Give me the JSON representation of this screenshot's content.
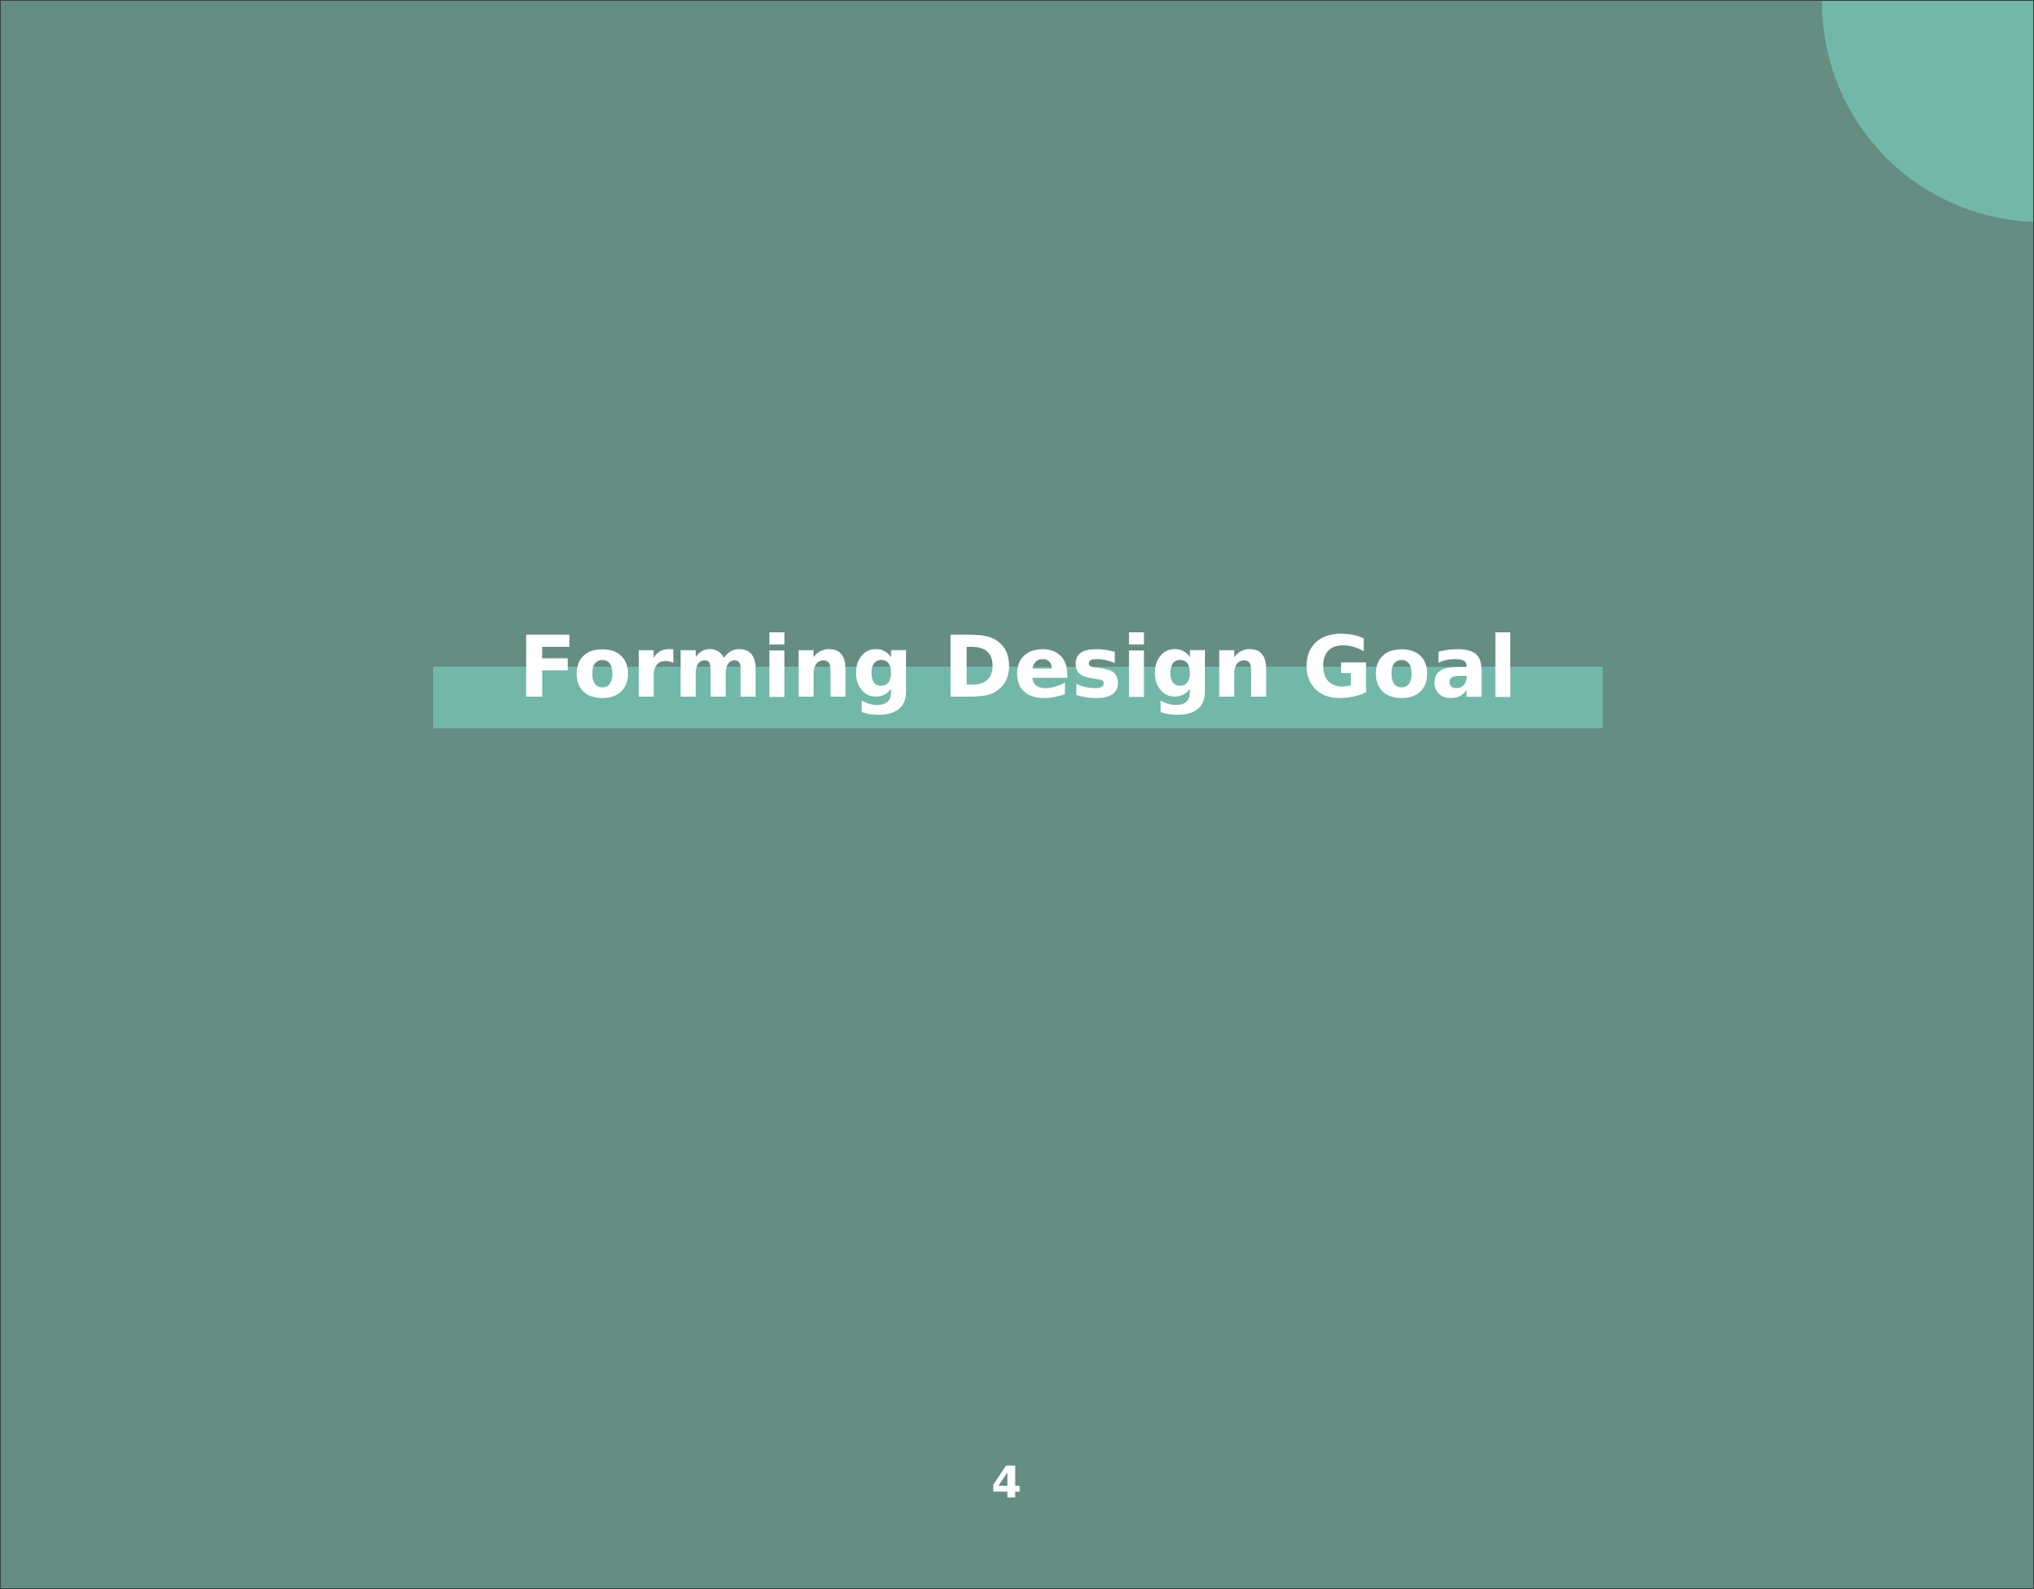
{
  "slide": {
    "title": "Forming Design Goal",
    "page_number": "4"
  },
  "colors": {
    "background": "#658d82",
    "accent": "#72b8a8",
    "text": "#ffffff"
  }
}
